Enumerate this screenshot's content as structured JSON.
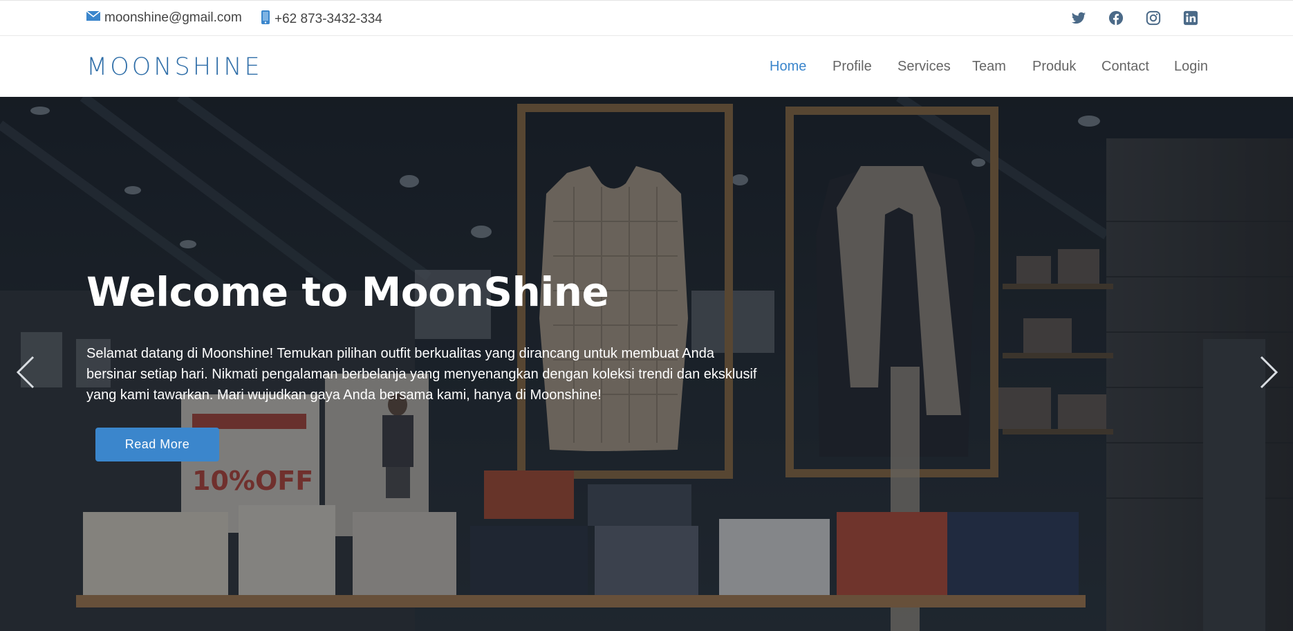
{
  "topbar": {
    "email": "moonshine@gmail.com",
    "phone": "+62 873-3432-334",
    "email_icon": "envelope-icon",
    "phone_icon": "phone-icon",
    "socials": [
      "twitter-icon",
      "facebook-icon",
      "instagram-icon",
      "linkedin-icon"
    ]
  },
  "header": {
    "logo": "MOONSHINE",
    "nav": [
      {
        "label": "Home",
        "active": true
      },
      {
        "label": "Profile"
      },
      {
        "label": "Services"
      },
      {
        "label": "Team"
      },
      {
        "label": "Produk"
      },
      {
        "label": "Contact"
      },
      {
        "label": "Login"
      }
    ]
  },
  "hero": {
    "title": "Welcome to MoonShine",
    "description": "Selamat datang di Moonshine! Temukan pilihan outfit berkualitas yang dirancang untuk membuat Anda bersinar setiap hari. Nikmati pengalaman berbelanja yang menyenangkan dengan koleksi trendi dan eksklusif yang kami tawarkan. Mari wujudkan gaya Anda bersama kami, hanya di Moonshine!",
    "button": "Read More",
    "prev_icon": "chevron-left-icon",
    "next_icon": "chevron-right-icon"
  },
  "colors": {
    "accent": "#3b86cc",
    "logo": "#2f6ea8",
    "social": "#4b6a88"
  }
}
